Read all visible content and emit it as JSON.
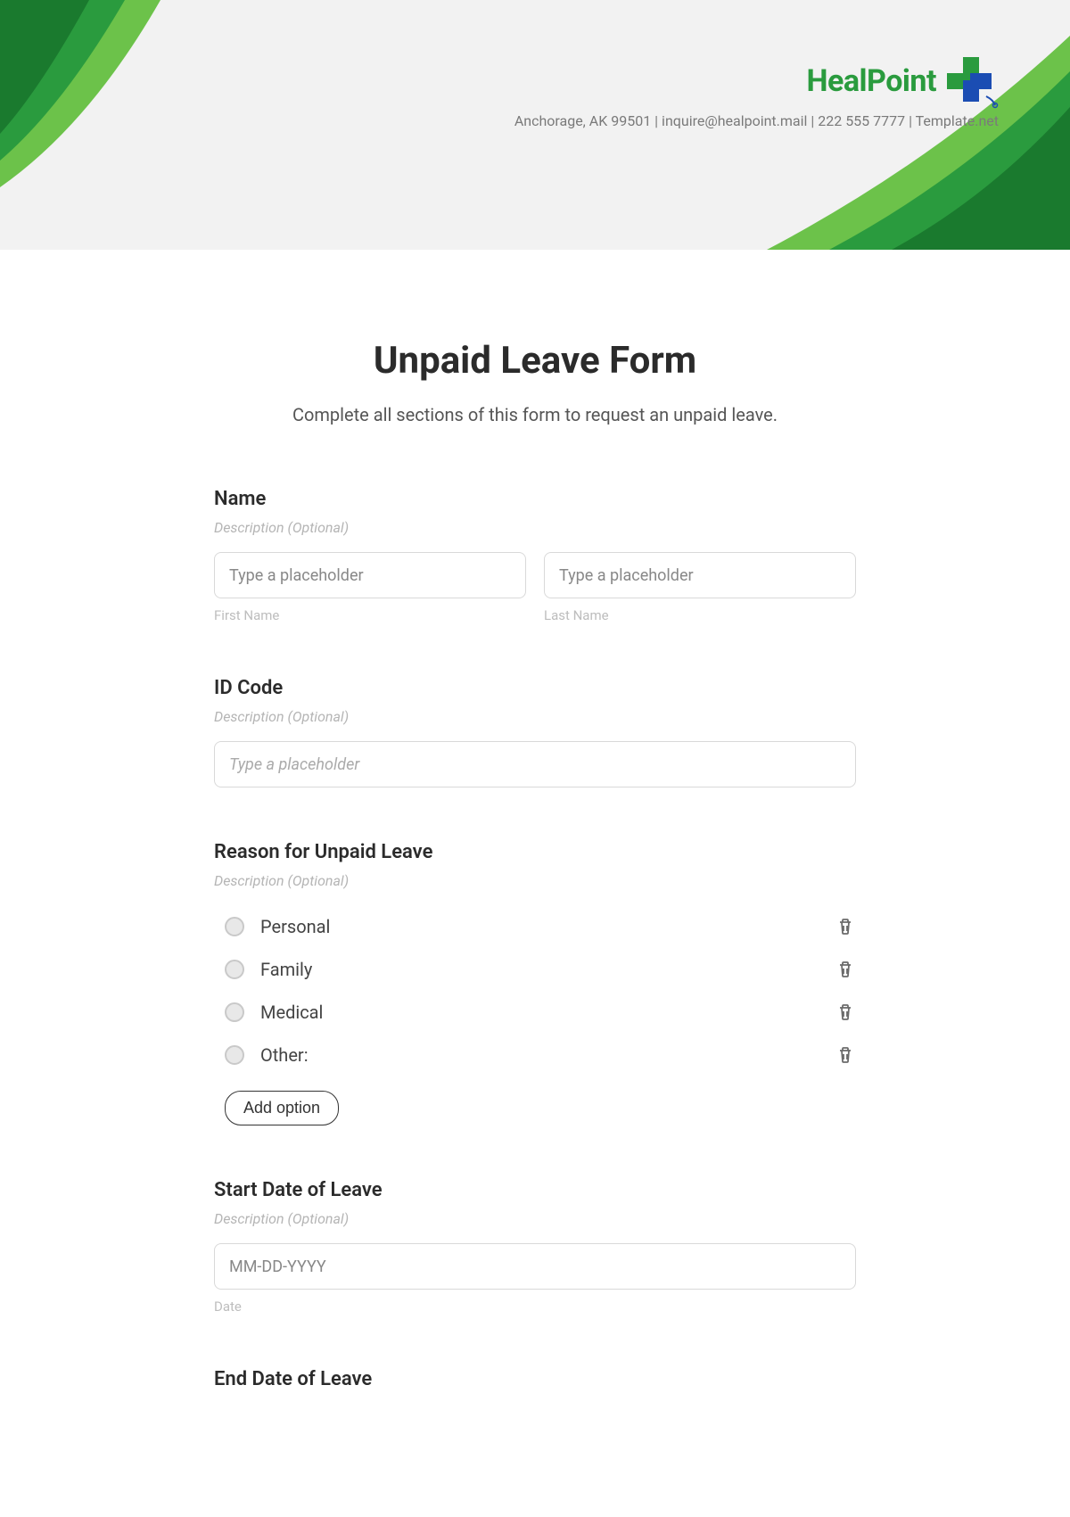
{
  "header": {
    "brand_name": "HealPoint",
    "contact_line": "Anchorage, AK 99501 | inquire@healpoint.mail | 222 555 7777 | Template.net"
  },
  "form": {
    "title": "Unpaid Leave Form",
    "subtitle": "Complete all sections of this form to request an unpaid leave.",
    "desc_placeholder": "Description (Optional)",
    "sections": {
      "name": {
        "label": "Name",
        "first_placeholder": "Type a placeholder",
        "first_sublabel": "First Name",
        "last_placeholder": "Type a placeholder",
        "last_sublabel": "Last Name"
      },
      "id_code": {
        "label": "ID Code",
        "placeholder": "Type a placeholder"
      },
      "reason": {
        "label": "Reason for Unpaid Leave",
        "options": [
          "Personal",
          "Family",
          "Medical",
          "Other:"
        ],
        "add_option": "Add option"
      },
      "start_date": {
        "label": "Start Date of Leave",
        "placeholder": "MM-DD-YYYY",
        "sublabel": "Date"
      },
      "end_date": {
        "label": "End Date of Leave"
      }
    }
  }
}
